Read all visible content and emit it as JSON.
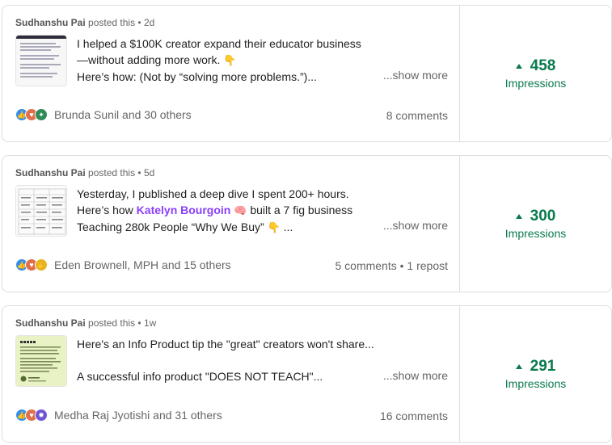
{
  "posts": [
    {
      "author": "Sudhanshu Pai",
      "posted_label": "posted this",
      "separator": "•",
      "age": "2d",
      "text_lines": [
        "I helped a $100K creator expand their educator business",
        "—without adding more work.",
        "Here’s how: (Not by “solving more problems.”)..."
      ],
      "emoji": "👇",
      "show_more": "...show more",
      "reactions": [
        "like",
        "love",
        "insightful"
      ],
      "reactor_summary": "Brunda Sunil and 30 others",
      "comments": "8 comments",
      "impressions": "458",
      "impressions_label": "Impressions"
    },
    {
      "author": "Sudhanshu Pai",
      "posted_label": "posted this",
      "separator": "•",
      "age": "5d",
      "text_lines": [
        "Yesterday, I published a deep dive I spent 200+ hours.",
        "Here’s how",
        "Katelyn Bourgoin",
        "built a 7 fig business",
        "Teaching 280k People “Why We Buy”",
        "..."
      ],
      "emoji_brain": "🧠",
      "emoji": "👇",
      "show_more": "...show more",
      "reactions": [
        "like",
        "love",
        "support"
      ],
      "reactor_summary": "Eden Brownell, MPH and 15 others",
      "comments": "5 comments • 1 repost",
      "impressions": "300",
      "impressions_label": "Impressions"
    },
    {
      "author": "Sudhanshu Pai",
      "posted_label": "posted this",
      "separator": "•",
      "age": "1w",
      "text_lines": [
        "Here's an Info Product tip the \"great\" creators won't share...",
        "A successful info product \"DOES NOT TEACH\"..."
      ],
      "show_more": "...show more",
      "reactions": [
        "like",
        "love",
        "celebrate"
      ],
      "reactor_summary": "Medha Raj Jyotishi and 31 others",
      "comments": "16 comments",
      "impressions": "291",
      "impressions_label": "Impressions"
    }
  ],
  "colors": {
    "accent_green": "#0a7a4d",
    "mention_purple": "#8a3ffc",
    "like": "#378fe9",
    "love": "#df704d",
    "insightful": "#2e8b57",
    "support": "#e6b422"
  }
}
